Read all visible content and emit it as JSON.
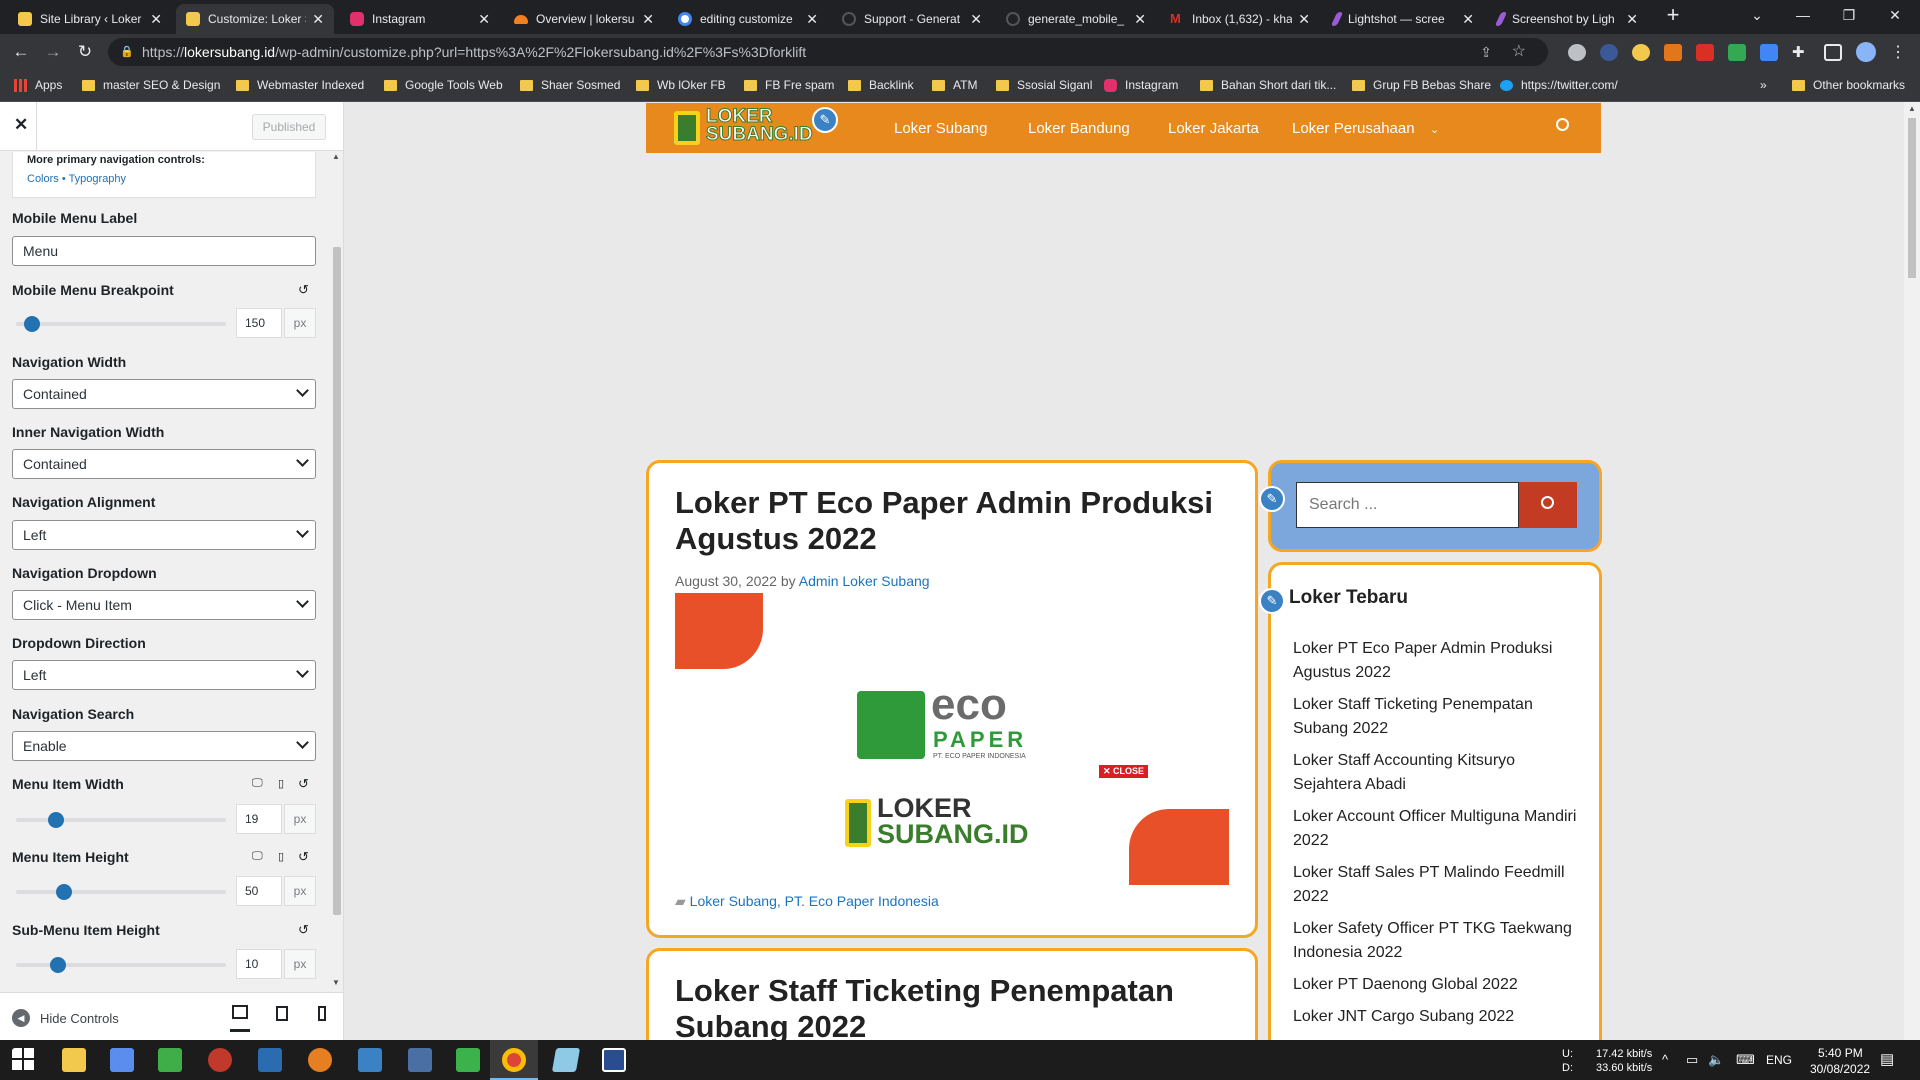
{
  "browser": {
    "tabs": [
      {
        "title": "Site Library ‹ Loker",
        "fav": "#f2c94c"
      },
      {
        "title": "Customize: Loker S",
        "fav": "#f2c94c"
      },
      {
        "title": "Instagram",
        "fav": "#e1306c"
      },
      {
        "title": "Overview | lokersu",
        "fav": "#f38020"
      },
      {
        "title": "editing customize",
        "fav": "#4285f4"
      },
      {
        "title": "Support - Generat",
        "fav": "#555555"
      },
      {
        "title": "generate_mobile_",
        "fav": "#555555"
      },
      {
        "title": "Inbox (1,632) - kha",
        "fav": "#d93025"
      },
      {
        "title": "Lightshot — scree",
        "fav": "#9c5bd6"
      },
      {
        "title": "Screenshot by Ligh",
        "fav": "#9c5bd6"
      }
    ],
    "url_prefix": "https://",
    "url_domain": "lokersubang.id",
    "url_rest": "/wp-admin/customize.php?url=https%3A%2F%2Flokersubang.id%2F%3Fs%3Dforklift",
    "bookmarks": [
      "Apps",
      "master SEO & Design",
      "Webmaster Indexed",
      "Google Tools Web",
      "Shaer Sosmed",
      "Wb lOker FB",
      "FB Fre spam",
      "Backlink",
      "ATM",
      "Ssosial Siganl",
      "Instagram",
      "Bahan Short dari tik...",
      "Grup FB Bebas Share",
      "https://twitter.com/"
    ],
    "other_bookmarks": "Other bookmarks"
  },
  "customizer": {
    "published": "Published",
    "more_controls": "More primary navigation controls:",
    "colors_link": "Colors",
    "typography_link": "Typography",
    "mobile_label_title": "Mobile Menu Label",
    "mobile_label_value": "Menu",
    "breakpoint_title": "Mobile Menu Breakpoint",
    "breakpoint_value": "150",
    "nav_width_title": "Navigation Width",
    "nav_width_value": "Contained",
    "inner_nav_width_title": "Inner Navigation Width",
    "inner_nav_width_value": "Contained",
    "nav_align_title": "Navigation Alignment",
    "nav_align_value": "Left",
    "nav_dropdown_title": "Navigation Dropdown",
    "nav_dropdown_value": "Click - Menu Item",
    "dropdown_dir_title": "Dropdown Direction",
    "dropdown_dir_value": "Left",
    "nav_search_title": "Navigation Search",
    "nav_search_value": "Enable",
    "item_width_title": "Menu Item Width",
    "item_width_value": "19",
    "item_height_title": "Menu Item Height",
    "item_height_value": "50",
    "sub_item_height_title": "Sub-Menu Item Height",
    "sub_item_height_value": "10",
    "unit": "px",
    "hide_controls": "Hide Controls"
  },
  "site": {
    "logo_top": "LOKER",
    "logo_bottom": "SUBANG.ID",
    "menu": [
      "Loker Subang",
      "Loker Bandung",
      "Loker Jakarta",
      "Loker Perusahaan"
    ],
    "post1_title": "Loker PT Eco Paper Admin Produksi Agustus 2022",
    "post1_date": "August 30, 2022",
    "post1_by": "by",
    "post1_author": "Admin Loker Subang",
    "post1_cats": "Loker Subang, PT. Eco Paper Indonesia",
    "eco_word": "eco",
    "eco_paper": "PAPER",
    "eco_sub": "PT. ECO PAPER INDONESIA",
    "close_badge": "CLOSE",
    "post2_title": "Loker Staff Ticketing Penempatan Subang 2022",
    "search_placeholder": "Search ...",
    "widget_title": "Loker Tebaru",
    "recent": [
      "Loker PT Eco Paper Admin Produksi Agustus 2022",
      "Loker Staff Ticketing Penempatan Subang 2022",
      "Loker Staff Accounting Kitsuryo Sejahtera Abadi",
      "Loker Account Officer Multiguna Mandiri 2022",
      "Loker Staff Sales PT Malindo Feedmill 2022",
      "Loker Safety Officer PT TKG Taekwang Indonesia 2022",
      "Loker PT Daenong Global 2022",
      "Loker JNT Cargo Subang 2022"
    ]
  },
  "taskbar": {
    "net_u": "U:",
    "net_d": "D:",
    "up_speed": "17.42 kbit/s",
    "down_speed": "33.60 kbit/s",
    "lang": "ENG",
    "time": "5:40 PM",
    "date": "30/08/2022"
  },
  "colors": {
    "brand_orange": "#e8891e",
    "wp_blue": "#2271b1",
    "card_border": "#f5a623"
  }
}
